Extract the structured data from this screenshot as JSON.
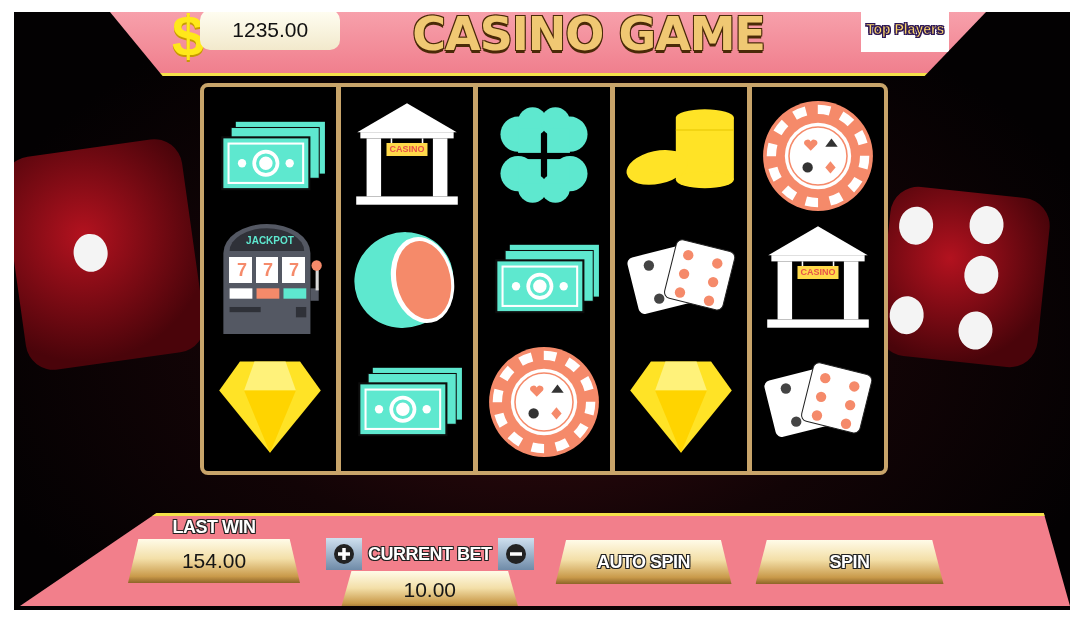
{
  "header": {
    "currency_symbol": "$",
    "balance": "1235.00",
    "title": "CASINO GAME",
    "top_players_button": "Top Players"
  },
  "reels": [
    {
      "symbols": [
        {
          "kind": "cash"
        },
        {
          "kind": "slot-machine",
          "sign": "JACKPOT",
          "digits": "777"
        },
        {
          "kind": "diamond"
        }
      ]
    },
    {
      "symbols": [
        {
          "kind": "casino",
          "sign": "CASINO"
        },
        {
          "kind": "melon"
        },
        {
          "kind": "cash"
        }
      ]
    },
    {
      "symbols": [
        {
          "kind": "clover"
        },
        {
          "kind": "cash"
        },
        {
          "kind": "chip"
        }
      ]
    },
    {
      "symbols": [
        {
          "kind": "coins"
        },
        {
          "kind": "dice"
        },
        {
          "kind": "diamond"
        }
      ]
    },
    {
      "symbols": [
        {
          "kind": "chip"
        },
        {
          "kind": "casino",
          "sign": "CASINO"
        },
        {
          "kind": "dice"
        }
      ]
    }
  ],
  "controls": {
    "last_win_label": "LAST WIN",
    "last_win": "154.00",
    "current_bet_label": "CURRENT BET",
    "current_bet": "10.00",
    "auto_spin_button": "AUTO SPIN",
    "spin_button": "SPIN"
  }
}
